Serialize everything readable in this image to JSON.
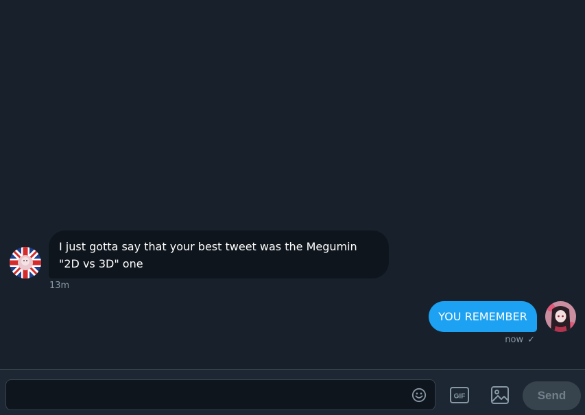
{
  "conversation": {
    "messages": [
      {
        "direction": "incoming",
        "text": "I just gotta say that your best tweet was the Megumin \"2D vs 3D\" one",
        "time": "13m"
      },
      {
        "direction": "outgoing",
        "text": "YOU REMEMBER",
        "time": "now",
        "status_icon": "✓"
      }
    ]
  },
  "composer": {
    "input_value": "",
    "input_placeholder": "",
    "send_label": "Send",
    "gif_label": "GIF",
    "icons": [
      "emoji-icon",
      "gif-icon",
      "image-icon"
    ]
  },
  "colors": {
    "background": "#18202b",
    "incoming_bubble": "#0f151d",
    "outgoing_bubble": "#1da1f2",
    "muted_text": "#8899a6",
    "composer_bg": "#1c2733",
    "send_disabled_bg": "#38444d",
    "send_disabled_text": "#72808c"
  }
}
